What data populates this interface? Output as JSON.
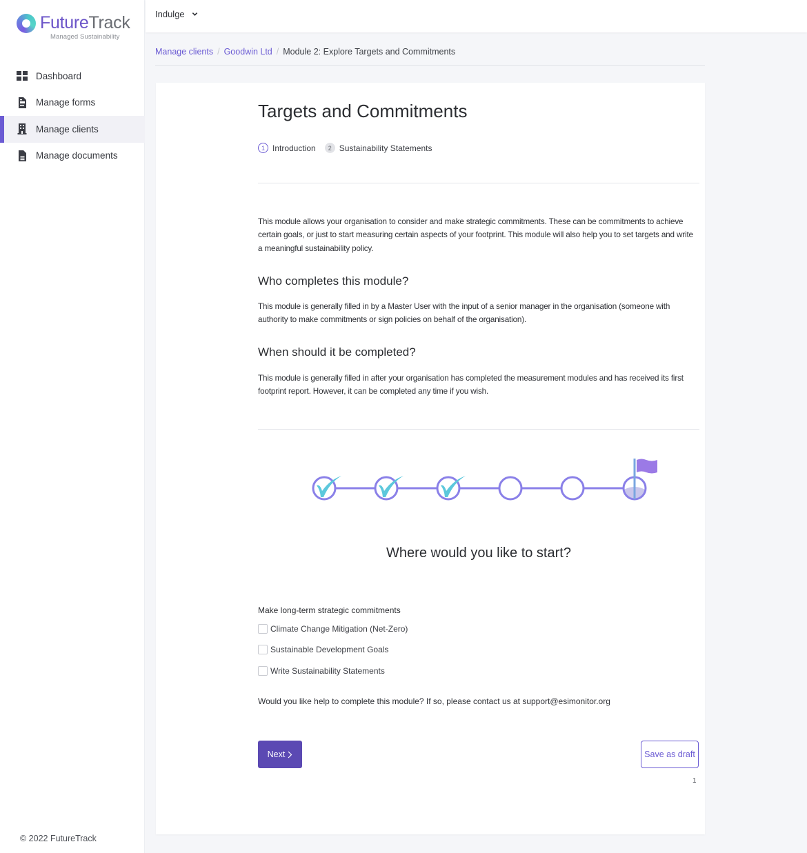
{
  "brand": {
    "name_part1": "Future",
    "name_part2": "Track",
    "tagline": "Managed Sustainability"
  },
  "sidebar": {
    "items": [
      {
        "label": "Dashboard",
        "icon": "dashboard-grid-icon",
        "active": false
      },
      {
        "label": "Manage forms",
        "icon": "form-document-icon",
        "active": false
      },
      {
        "label": "Manage clients",
        "icon": "building-icon",
        "active": true
      },
      {
        "label": "Manage documents",
        "icon": "document-icon",
        "active": false
      }
    ],
    "footer": "© 2022 FutureTrack"
  },
  "topbar": {
    "org_selected": "Indulge",
    "org_icon": "chevron-down-icon"
  },
  "breadcrumb": {
    "items": [
      {
        "label": "Manage clients",
        "link": true
      },
      {
        "label": "Goodwin Ltd",
        "link": true
      },
      {
        "label": "Module 2: Explore Targets and Commitments",
        "link": false
      }
    ],
    "separator": "/"
  },
  "module": {
    "title": "Targets and Commitments",
    "steps": [
      {
        "number": "1",
        "label": "Introduction",
        "active": true
      },
      {
        "number": "2",
        "label": "Sustainability Statements",
        "active": false
      }
    ],
    "intro": "This module allows your organisation to consider and make strategic commitments. These can be commitments to achieve certain goals, or just to start measuring certain aspects of your footprint. This module will also help you to set targets and write a meaningful sustainability policy.",
    "sections": [
      {
        "heading": "Who completes this module?",
        "body": "This module is generally filled in by a Master User with the input of a senior manager in the organisation (someone with authority to make commitments or sign policies on behalf of the organisation)."
      },
      {
        "heading": "When should it be completed?",
        "body": "This module is generally filled in after your organisation has completed the measurement modules and has received its first footprint report. However, it can be completed any time if you wish."
      }
    ],
    "progress": {
      "total_milestones": 6,
      "completed_milestones": 3,
      "final_icon": "flag-icon",
      "colors": {
        "track": "#8a80e8",
        "check": "#5cc8dc",
        "flag": "#9b7ae6",
        "pole": "#7aa6e0",
        "fill": "#c9c6ec"
      }
    },
    "start_question": "Where would you like to start?",
    "options_label": "Make long-term strategic commitments",
    "options": [
      {
        "label": "Climate Change Mitigation (Net-Zero)",
        "checked": false
      },
      {
        "label": "Sustainable Development Goals",
        "checked": false
      },
      {
        "label": "Write Sustainability Statements",
        "checked": false
      }
    ],
    "help_text": "Would you like help to complete this module? If so, please contact us at support@esimonitor.org",
    "next_label": "Next",
    "save_draft_label": "Save as draft",
    "page_number": "1"
  },
  "colors": {
    "accent": "#6b5bd3",
    "button_primary": "#5b49b3",
    "background": "#f5f6f9"
  }
}
